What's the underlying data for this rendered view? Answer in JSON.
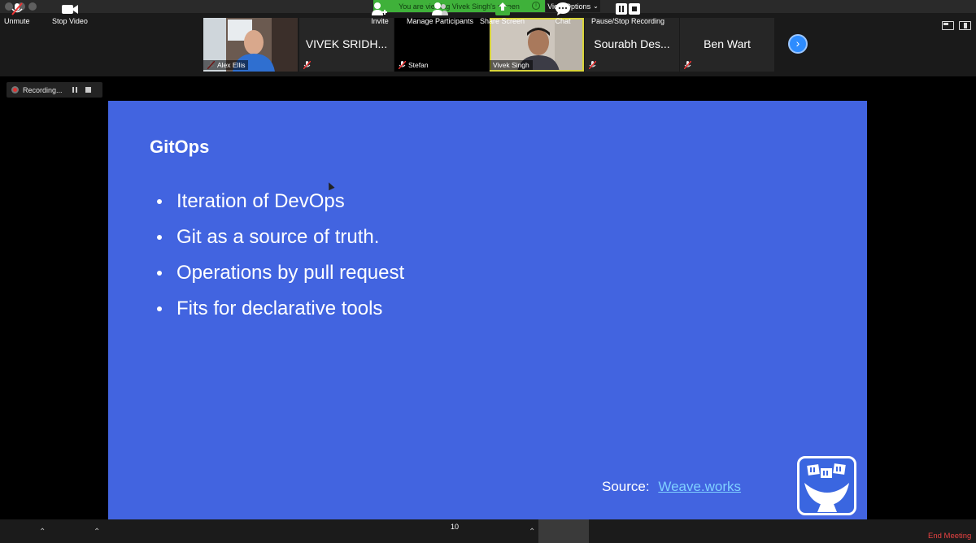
{
  "window": {
    "viewing_banner": "You are viewing Vivek Singh's screen",
    "view_options_label": "View Options"
  },
  "participants": [
    {
      "name": "Alex Ellis",
      "display": "video"
    },
    {
      "name": "VIVEK SRIDH...",
      "display": "name"
    },
    {
      "name": "Stefan",
      "display": "black"
    },
    {
      "name": "Vivek Singh",
      "display": "video",
      "active": true
    },
    {
      "name": "Sourabh Des...",
      "display": "name"
    },
    {
      "name": "Ben Wart",
      "display": "name"
    }
  ],
  "recording": {
    "label": "Recording..."
  },
  "slide": {
    "title": "GitOps",
    "bullets": [
      "Iteration of DevOps",
      "Git as a source of truth.",
      "Operations by pull request",
      "Fits for declarative tools"
    ],
    "source_label": "Source:",
    "source_link": "Weave.works"
  },
  "toolbar": {
    "unmute": "Unmute",
    "stop_video": "Stop Video",
    "invite": "Invite",
    "manage_participants": "Manage Participants",
    "participants_count": "10",
    "share_screen": "Share Screen",
    "chat": "Chat",
    "pause_stop_recording": "Pause/Stop Recording",
    "end_meeting": "End Meeting"
  },
  "colors": {
    "slide_bg": "#4264e0",
    "share_green": "#3fb13a",
    "end_red": "#e84242",
    "accent_blue": "#2d8cff"
  }
}
